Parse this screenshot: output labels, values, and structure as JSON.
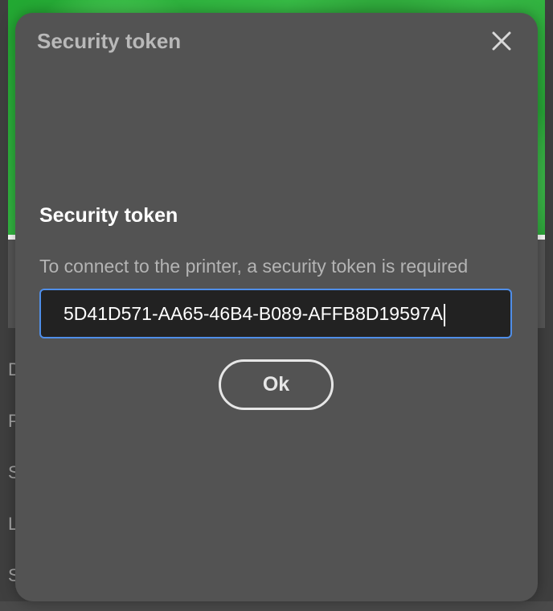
{
  "background": {
    "letters": [
      "D",
      "P",
      "S",
      "L",
      "S"
    ]
  },
  "dialog": {
    "title": "Security token",
    "close_icon": "close-icon",
    "heading": "Security token",
    "description": "To connect to the printer, a security token is required",
    "token_value": "5D41D571-AA65-46B4-B089-AFFB8D19597A",
    "ok_label": "Ok"
  },
  "colors": {
    "dialog_bg": "#535353",
    "input_border": "#4f8ee8",
    "input_bg": "#222222"
  }
}
